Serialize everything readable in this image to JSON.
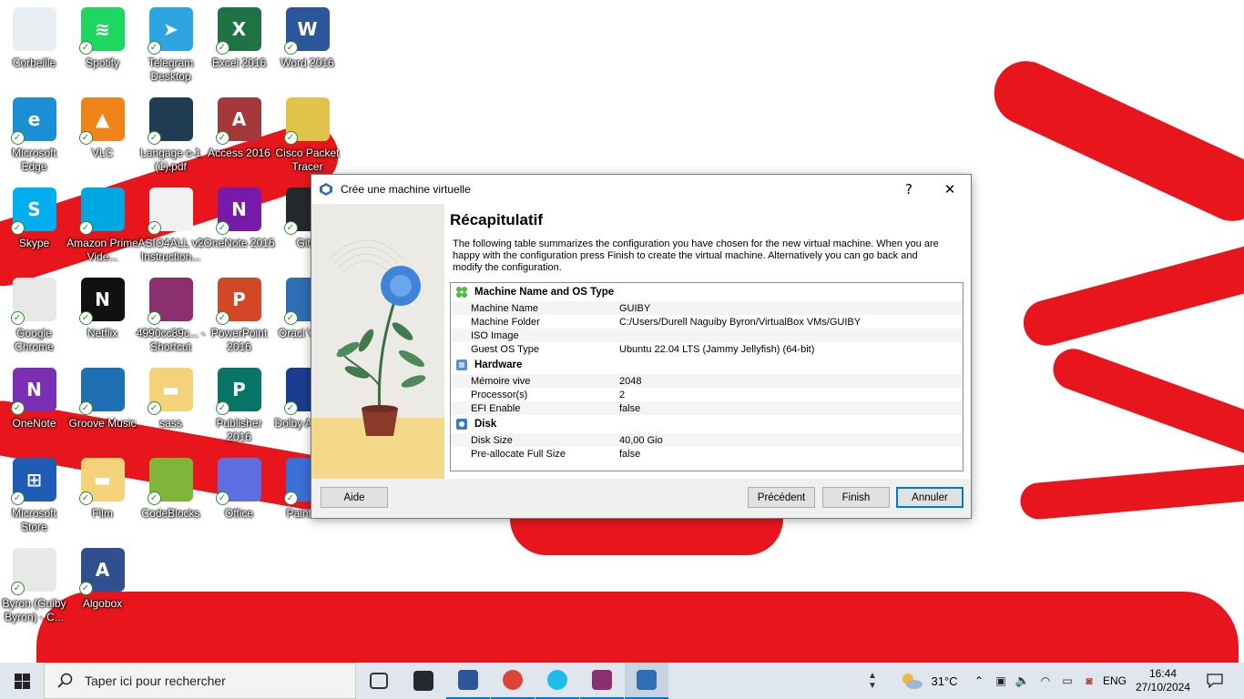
{
  "desktop": {
    "icons": [
      {
        "label": "Corbeille",
        "icon": "recycle-bin-icon",
        "color": "#e9eef2"
      },
      {
        "label": "Spotify",
        "icon": "spotify-icon",
        "color": "#1ed760"
      },
      {
        "label": "Telegram Desktop",
        "icon": "telegram-icon",
        "color": "#2ca5e0"
      },
      {
        "label": "Excel 2016",
        "icon": "excel-icon",
        "color": "#1f7244"
      },
      {
        "label": "Word 2016",
        "icon": "word-icon",
        "color": "#2b579a"
      },
      {
        "label": "Microsoft Edge",
        "icon": "edge-icon",
        "color": "#1a8fd3"
      },
      {
        "label": "VLC",
        "icon": "vlc-icon",
        "color": "#f08419"
      },
      {
        "label": "Langage c-1 (1).pdf",
        "icon": "pdf-icon",
        "color": "#1f3d52"
      },
      {
        "label": "Access 2016",
        "icon": "access-icon",
        "color": "#a4373a"
      },
      {
        "label": "Cisco Packet Tracer",
        "icon": "packet-tracer-icon",
        "color": "#e0c44a"
      },
      {
        "label": "Skype",
        "icon": "skype-icon",
        "color": "#00aff0"
      },
      {
        "label": "Amazon Prime Vide...",
        "icon": "prime-video-icon",
        "color": "#00a8e1"
      },
      {
        "label": "ASIO4ALL v2 Instruction...",
        "icon": "chrome-doc-icon",
        "color": "#f1f1f1"
      },
      {
        "label": "OneNote 2016",
        "icon": "onenote-2016-icon",
        "color": "#7719aa"
      },
      {
        "label": "GitH",
        "icon": "github-icon",
        "color": "#24292e"
      },
      {
        "label": "Google Chrome",
        "icon": "chrome-icon",
        "color": "#e8e8e8"
      },
      {
        "label": "Netflix",
        "icon": "netflix-icon",
        "color": "#111111"
      },
      {
        "label": "4990cc89c... - Shortcut",
        "icon": "winrar-icon",
        "color": "#8b2f6e"
      },
      {
        "label": "PowerPoint 2016",
        "icon": "powerpoint-icon",
        "color": "#d24726"
      },
      {
        "label": "Oracl Virtua",
        "icon": "virtualbox-icon",
        "color": "#2f6db5"
      },
      {
        "label": "OneNote",
        "icon": "onenote-icon",
        "color": "#7b2fb5"
      },
      {
        "label": "Groove Music",
        "icon": "groove-music-icon",
        "color": "#1f6fb5"
      },
      {
        "label": "sass",
        "icon": "folder-icon",
        "color": "#f3d27a"
      },
      {
        "label": "Publisher 2016",
        "icon": "publisher-icon",
        "color": "#077568"
      },
      {
        "label": "Dolby Access",
        "icon": "dolby-icon",
        "color": "#1b3d8f"
      },
      {
        "label": "Microsoft Store",
        "icon": "store-icon",
        "color": "#1e5db3"
      },
      {
        "label": "Film",
        "icon": "folder-icon",
        "color": "#f3d27a"
      },
      {
        "label": "CodeBlocks",
        "icon": "codeblocks-icon",
        "color": "#7fb63a"
      },
      {
        "label": "Office",
        "icon": "office-icon",
        "color": "#5c6ee0"
      },
      {
        "label": "Paint 3D",
        "icon": "paint3d-icon",
        "color": "#3a6fd8"
      },
      {
        "label": "Byron (Guiby Byron) - C...",
        "icon": "chrome-profile-icon",
        "color": "#e8e8e8"
      },
      {
        "label": "Algobox",
        "icon": "algobox-icon",
        "color": "#2f4f8f"
      }
    ]
  },
  "dialog": {
    "title": "Crée une machine virtuelle",
    "help_glyph": "?",
    "close_glyph": "✕",
    "heading": "Récapitulatif",
    "description": "The following table summarizes the configuration you have chosen for the new virtual machine. When you are happy with the configuration press Finish to create the virtual machine. Alternatively you can go back and modify the configuration.",
    "sections": [
      {
        "title": "Machine Name and OS Type",
        "icon": "os-type-icon",
        "rows": [
          {
            "key": "Machine Name",
            "value": "GUIBY"
          },
          {
            "key": "Machine Folder",
            "value": "C:/Users/Durell Naguiby Byron/VirtualBox VMs/GUIBY"
          },
          {
            "key": "ISO Image",
            "value": ""
          },
          {
            "key": "Guest OS Type",
            "value": "Ubuntu 22.04 LTS (Jammy Jellyfish) (64-bit)"
          }
        ]
      },
      {
        "title": "Hardware",
        "icon": "hardware-chip-icon",
        "rows": [
          {
            "key": "Mémoire vive",
            "value": "2048"
          },
          {
            "key": "Processor(s)",
            "value": "2"
          },
          {
            "key": "EFI Enable",
            "value": "false"
          }
        ]
      },
      {
        "title": "Disk",
        "icon": "disk-icon",
        "rows": [
          {
            "key": "Disk Size",
            "value": "40,00 Gio"
          },
          {
            "key": "Pre-allocate Full Size",
            "value": "false"
          }
        ]
      }
    ],
    "buttons": {
      "help": "Aide",
      "back": "Précédent",
      "finish": "Finish",
      "cancel": "Annuler"
    }
  },
  "taskbar": {
    "search_placeholder": "Taper ici pour rechercher",
    "pinned": [
      "task-view-icon",
      "github-icon",
      "word-icon",
      "chrome-icon",
      "internet-explorer-icon",
      "winrar-icon",
      "virtualbox-icon"
    ],
    "weather_temp": "31°C",
    "language": "ENG",
    "time": "16:44",
    "date": "27/10/2024",
    "accent": "#0078d7"
  }
}
